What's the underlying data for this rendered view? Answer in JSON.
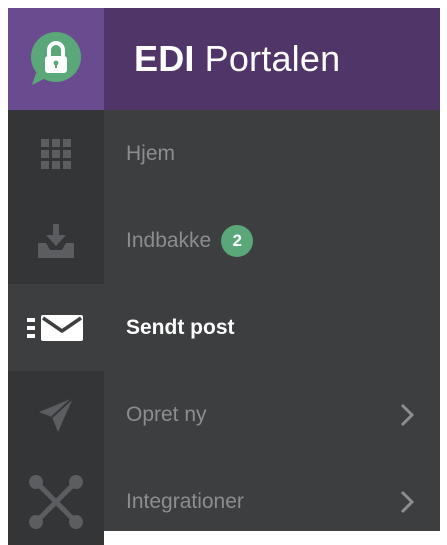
{
  "header": {
    "title_bold": "EDI",
    "title_rest": "Portalen",
    "logo_icon": "chat-lock-icon",
    "colors": {
      "logo_bg": "#6a4b8f",
      "title_bg": "#4f3568",
      "logo_green": "#5aa77a"
    }
  },
  "nav": {
    "items": [
      {
        "label": "Hjem",
        "icon": "grid-icon"
      },
      {
        "label": "Indbakke",
        "icon": "inbox-download-icon",
        "badge": "2"
      },
      {
        "label": "Sendt post",
        "icon": "sent-mail-icon",
        "active": true
      },
      {
        "label": "Opret ny",
        "icon": "paper-plane-icon",
        "chevron": "chevron-right-icon"
      },
      {
        "label": "Integrationer",
        "icon": "network-icon",
        "chevron": "chevron-right-icon"
      }
    ],
    "colors": {
      "bg": "#3d3e40",
      "icon_bg": "#343537",
      "label": "#8c8d90",
      "active_label": "#ffffff",
      "badge": "#5aa77a"
    }
  }
}
